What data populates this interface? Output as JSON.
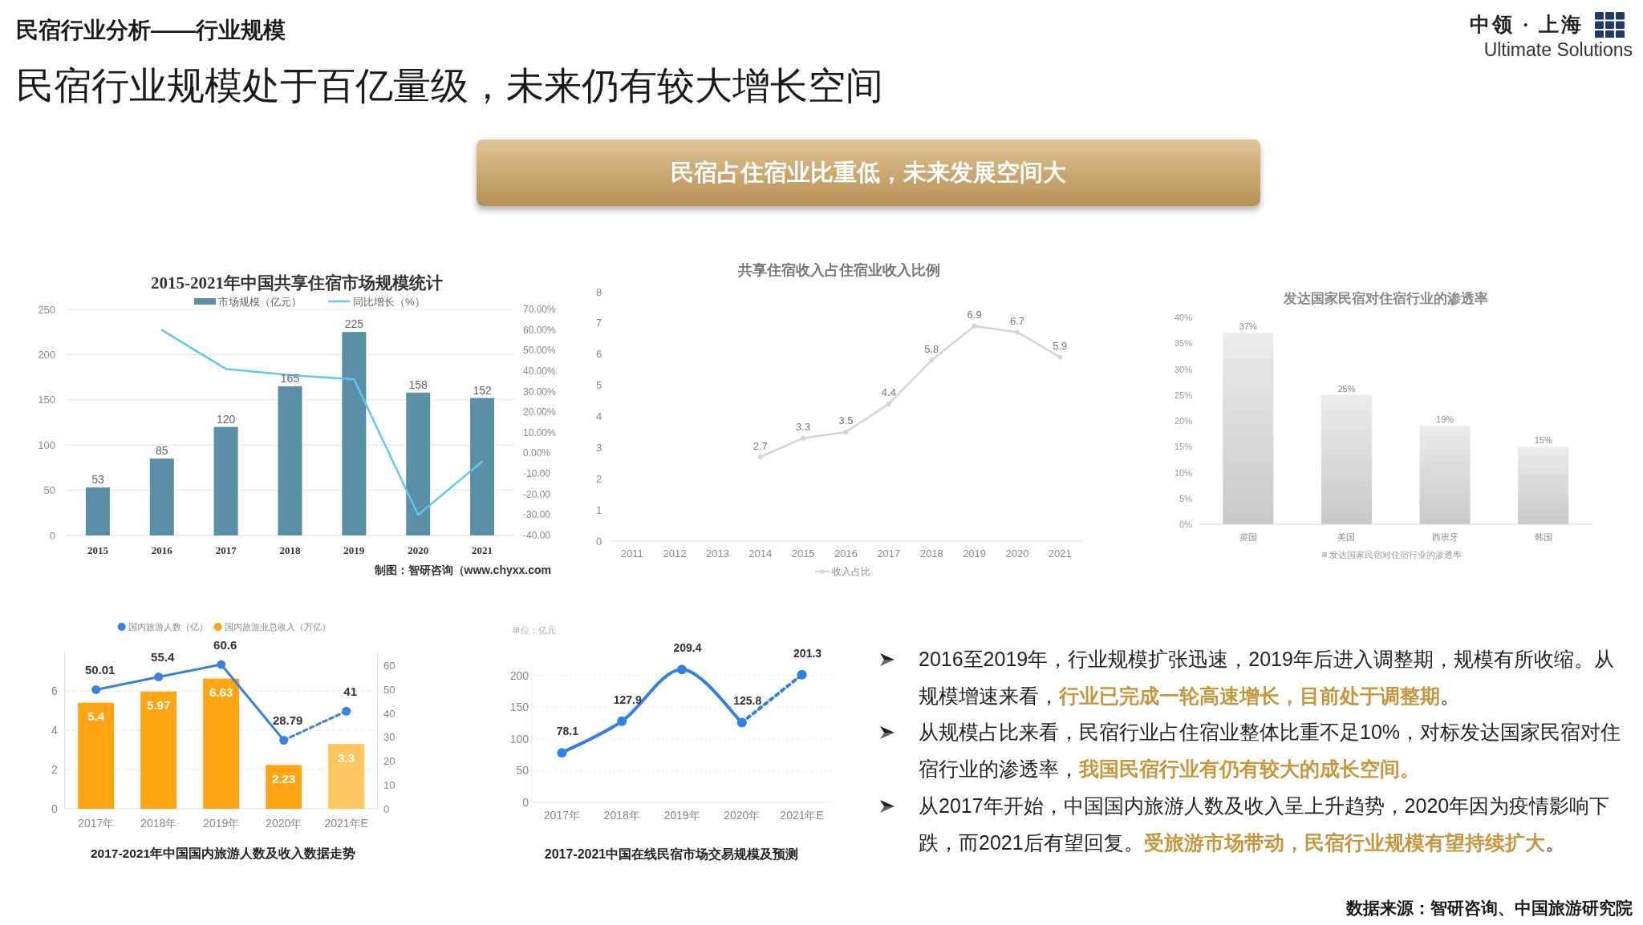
{
  "header": {
    "section": "民宿行业分析——行业规模",
    "title": "民宿行业规模处于百亿量级，未来仍有较大增长空间"
  },
  "logo": {
    "name_cn": "中领 · 上海",
    "name_en": "Ultimate Solutions"
  },
  "banner": {
    "text": "民宿占住宿业比重低，未来发展空间大"
  },
  "market_size_chart": {
    "chart_data": {
      "type": "bar",
      "title": "2015-2021年中国共享住宿市场规模统计",
      "legend": "top",
      "categories": [
        "2015",
        "2016",
        "2017",
        "2018",
        "2019",
        "2020",
        "2021"
      ],
      "series": [
        {
          "name": "市场规模（亿元）",
          "color": "#5b8fa8",
          "values": [
            53,
            85,
            120,
            165,
            225,
            158,
            152
          ]
        },
        {
          "name": "同比增长（%）",
          "color": "#5ec8f2",
          "type": "line",
          "axis": "y2",
          "values": [
            null,
            60,
            41,
            38,
            36,
            -30,
            -4
          ]
        }
      ],
      "ylim": [
        0,
        250
      ],
      "yticks": [
        0,
        50,
        100,
        150,
        200,
        250
      ],
      "y2lim": [
        -40,
        70
      ],
      "y2ticks": [
        {
          "value": 70,
          "label": "70.00%"
        },
        {
          "value": 60,
          "label": "60.00%"
        },
        {
          "value": 50,
          "label": "50.00%"
        },
        {
          "value": 40,
          "label": "40.00%"
        },
        {
          "value": 30,
          "label": "30.00%"
        },
        {
          "value": 20,
          "label": "20.00%"
        },
        {
          "value": 10,
          "label": "10.00%"
        },
        {
          "value": 0,
          "label": "0.00%"
        },
        {
          "value": -10,
          "label": "-10.00"
        },
        {
          "value": -20,
          "label": "-20.00"
        },
        {
          "value": -30,
          "label": "-30.00"
        },
        {
          "value": -40,
          "label": "-40.00"
        }
      ],
      "grid": true,
      "value_labels": [
        [
          "53",
          "85",
          "120",
          "165",
          "225",
          "158",
          "152"
        ],
        [
          null,
          null,
          null,
          null,
          null,
          null,
          null
        ]
      ]
    },
    "caption": "制图：智研咨询（www.chyxx.com"
  },
  "share_chart": {
    "chart_data": {
      "type": "line",
      "title": "共享住宿收入占住宿业收入比例",
      "legend": "bottom",
      "categories": [
        "2011",
        "2012",
        "2013",
        "2014",
        "2015",
        "2016",
        "2017",
        "2018",
        "2019",
        "2020",
        "2021"
      ],
      "series": [
        {
          "name": "收入占比",
          "color": "#d4d4d4",
          "marker": "circle",
          "values": [
            null,
            null,
            null,
            2.7,
            3.3,
            3.5,
            4.4,
            5.8,
            6.9,
            6.7,
            5.9
          ]
        }
      ],
      "ylim": [
        0,
        8
      ],
      "yticks": [
        0,
        1,
        2,
        3,
        4,
        5,
        6,
        7,
        8
      ],
      "data_labels": true
    }
  },
  "penetration_chart": {
    "chart_data": {
      "type": "bar",
      "title": "发达国家民宿对住宿行业的渗透率",
      "legend": "bottom",
      "categories": [
        "英国",
        "美国",
        "西班牙",
        "韩国"
      ],
      "series": [
        {
          "name": "发达国家民宿对住宿行业的渗透率",
          "color": "#c8c8c8",
          "values": [
            37,
            25,
            19,
            15
          ]
        }
      ],
      "ylim": [
        0,
        40
      ],
      "yticks": [
        {
          "value": 0,
          "label": "0%"
        },
        {
          "value": 5,
          "label": "5%"
        },
        {
          "value": 10,
          "label": "10%"
        },
        {
          "value": 15,
          "label": "15%"
        },
        {
          "value": 20,
          "label": "20%"
        },
        {
          "value": 25,
          "label": "25%"
        },
        {
          "value": 30,
          "label": "30%"
        },
        {
          "value": 35,
          "label": "35%"
        },
        {
          "value": 40,
          "label": "40%"
        }
      ],
      "value_labels": [
        "37%",
        "25%",
        "19%",
        "15%"
      ]
    }
  },
  "tourism_chart": {
    "chart_data": {
      "type": "bar",
      "title": "2017-2021年中国国内旅游人数及收入数据走势",
      "legend": "top",
      "stacked": true,
      "categories": [
        "2017年",
        "2018年",
        "2019年",
        "2020年",
        "2021年E"
      ],
      "series": [
        {
          "name": "国内旅游人数（亿）",
          "color": "#3a80e0",
          "type": "line",
          "axis": "y2",
          "marker": "circle",
          "values": [
            50.01,
            55.4,
            60.6,
            28.79,
            null
          ]
        },
        {
          "color": "#3a80e0",
          "type": "line",
          "axis": "y2",
          "marker": "circle",
          "line_style": "dashed",
          "values": [
            null,
            null,
            null,
            28.79,
            41
          ]
        },
        {
          "name": "国内旅游业总收入（万亿）",
          "color": "#ffa412",
          "values": [
            5.4,
            5.97,
            6.63,
            2.23,
            null
          ]
        },
        {
          "color": "#ffc55e",
          "values": [
            null,
            null,
            null,
            null,
            3.3
          ]
        }
      ],
      "ylim": [
        0,
        8
      ],
      "yticks": [
        0,
        2,
        4,
        6
      ],
      "y2lim": [
        0,
        66
      ],
      "y2ticks": [
        0,
        10,
        20,
        30,
        40,
        50,
        60
      ],
      "grid": true,
      "value_labels": [
        [
          "50.01",
          "55.4",
          "60.6",
          "28.79",
          null
        ],
        [
          null,
          null,
          null,
          null,
          "41"
        ],
        [
          "5.4",
          "5.97",
          "6.63",
          "2.23",
          null
        ],
        [
          null,
          null,
          null,
          null,
          "3.3"
        ]
      ]
    }
  },
  "online_market_chart": {
    "chart_data": {
      "type": "line",
      "title": "2017-2021中国在线民宿市场交易规模及预测",
      "ylabel": "单位：亿元",
      "categories": [
        "2017年",
        "2018年",
        "2019年",
        "2020年",
        "2021年E"
      ],
      "series": [
        {
          "color": "#2f80e6",
          "marker": "circle",
          "values": [
            78.1,
            127.9,
            209.4,
            125.8,
            null
          ]
        },
        {
          "color": "#2f80e6",
          "marker": "circle",
          "line_style": "dashed",
          "values": [
            null,
            null,
            null,
            125.8,
            201.3
          ]
        }
      ],
      "ylim": [
        0,
        220
      ],
      "yticks": [
        0,
        50,
        100,
        150,
        200
      ],
      "grid": true,
      "value_labels": [
        [
          "78.1",
          "127.9",
          "209.4",
          "125.8",
          null
        ],
        [
          null,
          null,
          null,
          null,
          "201.3"
        ]
      ]
    }
  },
  "bullets": [
    "2016至2019年，行业规模扩张迅速，2019年后进入调整期，规模有所收缩。从规模增速来看，**行业已完成一轮高速增长，目前处于调整期**。",
    "从规模占比来看，民宿行业占住宿业整体比重不足10%，对标发达国家民宿对住宿行业的渗透率，**我国民宿行业有仍有较大的成长空间。**",
    "从2017年开始，中国国内旅游人数及收入呈上升趋势，2020年因为疫情影响下跌，而2021后有望回复。**受旅游市场带动，民宿行业规模有望持续扩大**。"
  ],
  "source": "数据来源：智研咨询、中国旅游研究院"
}
